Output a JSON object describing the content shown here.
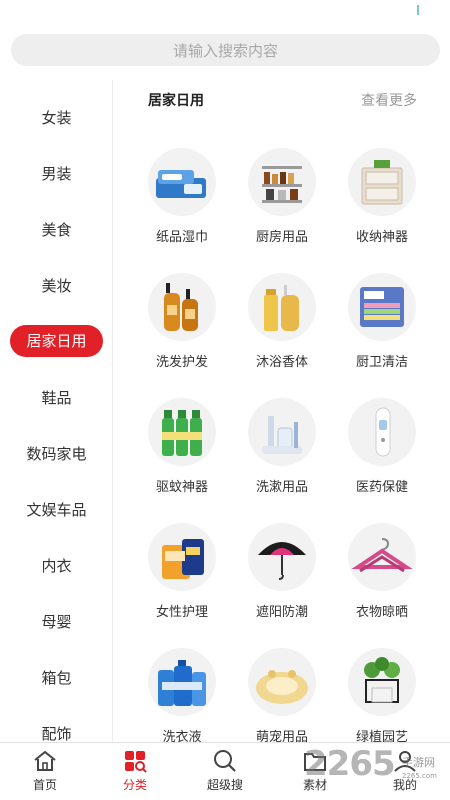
{
  "search": {
    "placeholder": "请输入搜索内容"
  },
  "sidebar": {
    "items": [
      {
        "label": "女装"
      },
      {
        "label": "男装"
      },
      {
        "label": "美食"
      },
      {
        "label": "美妆"
      },
      {
        "label": "居家日用",
        "active": true
      },
      {
        "label": "鞋品"
      },
      {
        "label": "数码家电"
      },
      {
        "label": "文娱车品"
      },
      {
        "label": "内衣"
      },
      {
        "label": "母婴"
      },
      {
        "label": "箱包"
      },
      {
        "label": "配饰"
      }
    ]
  },
  "section": {
    "title": "居家日用",
    "more": "查看更多"
  },
  "grid": {
    "items": [
      {
        "label": "纸品湿巾",
        "icon": "tissue-pack-icon"
      },
      {
        "label": "厨房用品",
        "icon": "kitchen-rack-icon"
      },
      {
        "label": "收纳神器",
        "icon": "storage-box-icon"
      },
      {
        "label": "洗发护发",
        "icon": "shampoo-bottles-icon"
      },
      {
        "label": "沐浴香体",
        "icon": "body-wash-icon"
      },
      {
        "label": "厨卫清洁",
        "icon": "cleaning-sponge-icon"
      },
      {
        "label": "驱蚊神器",
        "icon": "mosquito-repellent-icon"
      },
      {
        "label": "洗漱用品",
        "icon": "toiletries-icon"
      },
      {
        "label": "医药保健",
        "icon": "thermometer-icon"
      },
      {
        "label": "女性护理",
        "icon": "feminine-care-icon"
      },
      {
        "label": "遮阳防潮",
        "icon": "umbrella-icon"
      },
      {
        "label": "衣物晾晒",
        "icon": "clothes-hanger-icon"
      },
      {
        "label": "洗衣液",
        "icon": "laundry-detergent-icon"
      },
      {
        "label": "萌宠用品",
        "icon": "pet-bed-icon"
      },
      {
        "label": "绿植园艺",
        "icon": "potted-plant-icon"
      }
    ]
  },
  "tabbar": {
    "items": [
      {
        "label": "首页",
        "icon": "home-icon"
      },
      {
        "label": "分类",
        "icon": "category-icon",
        "active": true
      },
      {
        "label": "超级搜",
        "icon": "search-icon"
      },
      {
        "label": "素材",
        "icon": "folder-icon"
      },
      {
        "label": "我的",
        "icon": "user-icon"
      }
    ]
  },
  "watermark": {
    "number": "2265",
    "text": "手游网",
    "url": "2265.com"
  },
  "colors": {
    "accent": "#e12028",
    "bubble": "#f2f2f2",
    "search_bg": "#eeeeee"
  }
}
